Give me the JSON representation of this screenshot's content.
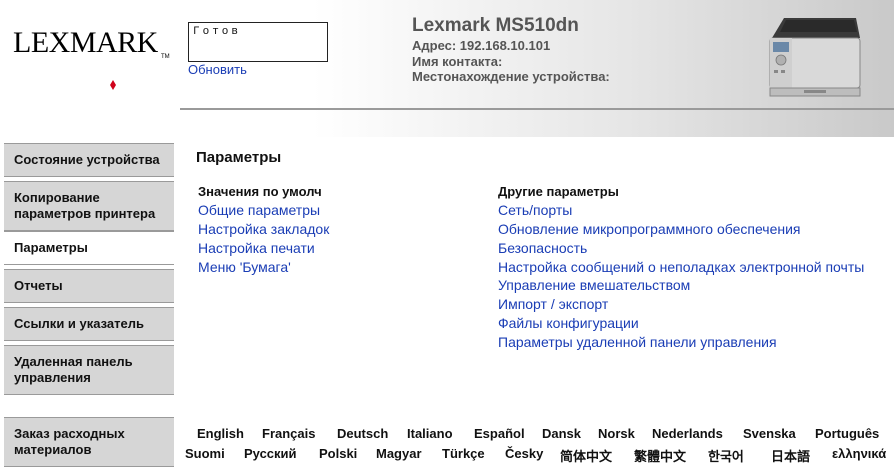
{
  "brand": {
    "logo_text": "LEXMARK",
    "tm": "TM"
  },
  "status": {
    "text": "Готов",
    "refresh_label": "Обновить"
  },
  "device": {
    "title": "Lexmark MS510dn",
    "address": "Адрес: 192.168.10.101",
    "contact": "Имя контакта:",
    "location": "Местонахождение устройства:"
  },
  "sidebar": {
    "items": [
      {
        "label": "Состояние устройства"
      },
      {
        "label": "Копирование параметров принтера"
      },
      {
        "label": "Параметры"
      },
      {
        "label": "Отчеты"
      },
      {
        "label": "Ссылки и указатель"
      },
      {
        "label": "Удаленная панель управления"
      },
      {
        "label": "Заказ расходных материалов"
      }
    ]
  },
  "main": {
    "title": "Параметры",
    "left_column": {
      "heading": "Значения по умолч",
      "links": [
        "Общие параметры",
        "Настройка закладок",
        "Настройка печати",
        "Меню 'Бумага'"
      ]
    },
    "right_column": {
      "heading": "Другие параметры",
      "links": [
        "Сеть/порты",
        "Обновление микропрограммного обеспечения",
        "Безопасность",
        "Настройка сообщений о неполадках электронной почты",
        "Управление вмешательством",
        "Импорт / экспорт",
        "Файлы конфигурации",
        "Параметры удаленной панели управления"
      ]
    }
  },
  "languages": {
    "row1": [
      "English",
      "Français",
      "Deutsch",
      "Italiano",
      "Español",
      "Dansk",
      "Norsk",
      "Nederlands",
      "Svenska",
      "Português"
    ],
    "row2": [
      "Suomi",
      "Русский",
      "Polski",
      "Magyar",
      "Türkçe",
      "Česky",
      "简体中文",
      "繁體中文",
      "한국어",
      "日本語",
      "ελληνικά"
    ]
  },
  "colors": {
    "link": "#1a3db5",
    "sidebar_bg": "#d6d6d6",
    "logo_accent": "#d0021b"
  }
}
